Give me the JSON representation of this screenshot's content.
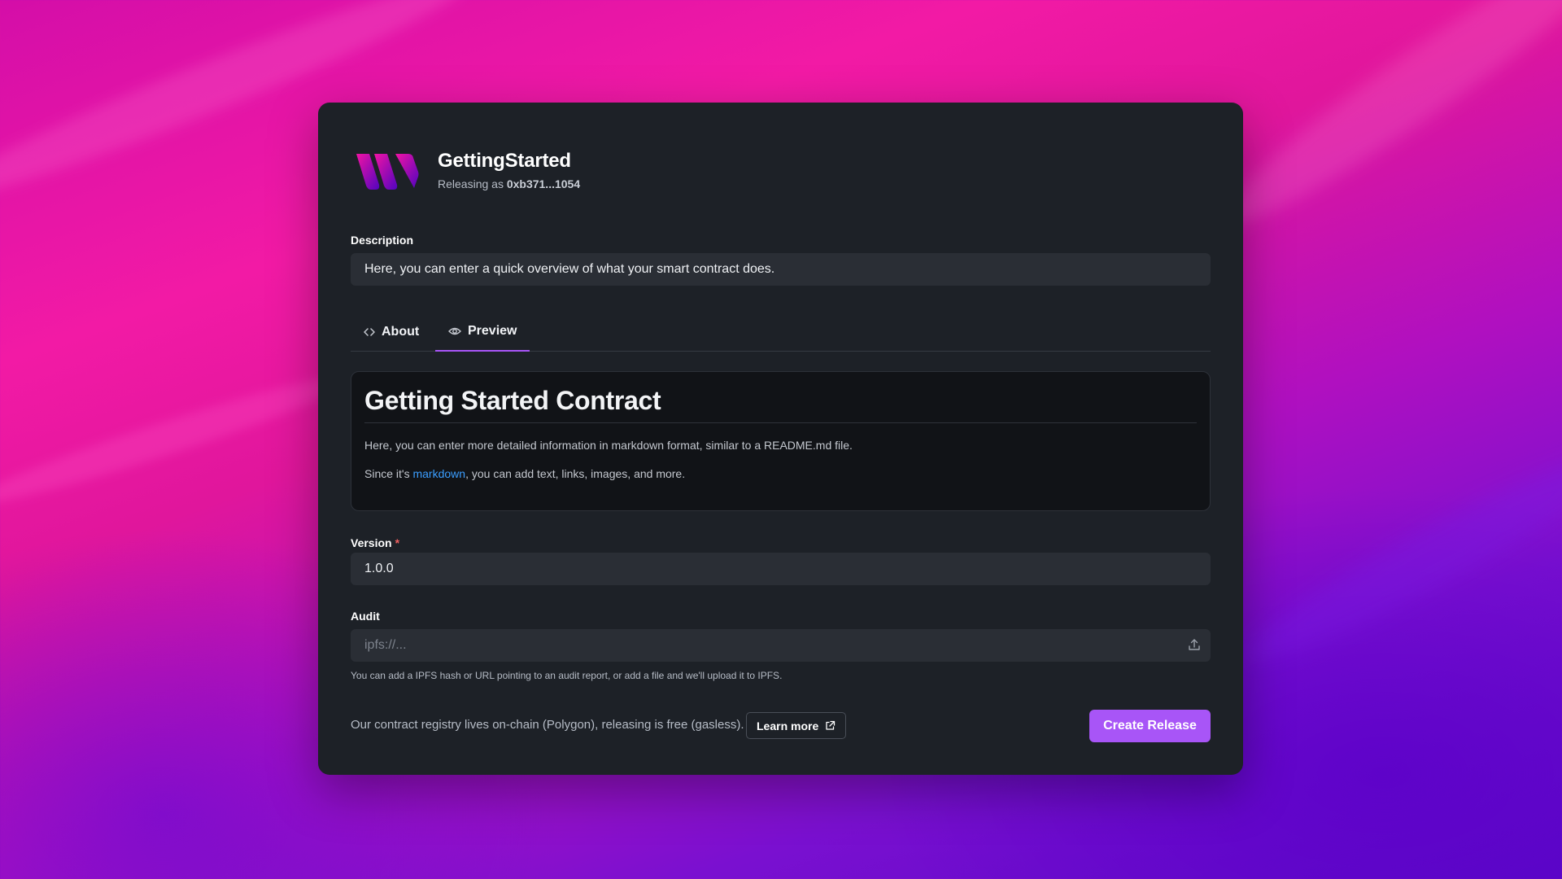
{
  "app": {
    "name": "GettingStarted",
    "releasing_prefix": "Releasing as",
    "releasing_address": "0xb371...1054"
  },
  "description": {
    "label": "Description",
    "value": "Here, you can enter a quick overview of what your smart contract does."
  },
  "tabs": [
    {
      "label": "About",
      "icon": "code-icon",
      "active": false
    },
    {
      "label": "Preview",
      "icon": "eye-icon",
      "active": true
    }
  ],
  "preview": {
    "heading": "Getting Started Contract",
    "paragraph1": "Here, you can enter more detailed information in markdown format, similar to a README.md file.",
    "paragraph2_before": "Since it's ",
    "paragraph2_link": "markdown",
    "paragraph2_after": ", you can add text, links, images, and more."
  },
  "version": {
    "label": "Version",
    "required_mark": "*",
    "value": "1.0.0"
  },
  "audit": {
    "label": "Audit",
    "placeholder": "ipfs://...",
    "hint": "You can add a IPFS hash or URL pointing to an audit report, or add a file and we'll upload it to IPFS."
  },
  "footer": {
    "text": "Our contract registry lives on-chain (Polygon), releasing is free (gasless).",
    "learn_more": "Learn more",
    "create_button": "Create Release"
  },
  "colors": {
    "accent": "#a855f7",
    "card": "#1d2127",
    "link": "#3b9eff"
  }
}
